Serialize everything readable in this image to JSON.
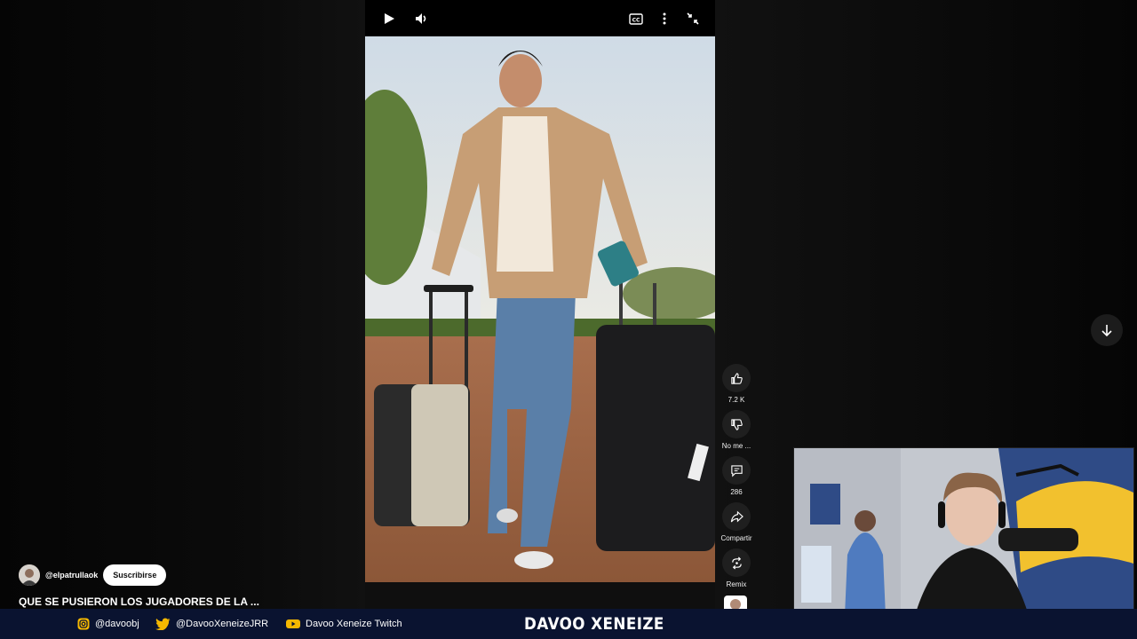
{
  "short": {
    "channel": "@elpatrullaok",
    "subscribe_label": "Suscribirse",
    "title": "QUE SE PUSIERON LOS JUGADORES DE LA ..."
  },
  "actions": {
    "like_count": "7.2 K",
    "dislike_label": "No me ...",
    "comments_count": "286",
    "share_label": "Compartir",
    "remix_label": "Remix"
  },
  "banner": {
    "instagram": "@davoobj",
    "twitter": "@DavooXeneizeJRR",
    "twitch": "Davoo Xeneize Twitch",
    "brand": "DAVOO XENEIZE"
  },
  "icons": {
    "play": "play-icon",
    "volume": "volume-icon",
    "captions": "captions-icon",
    "more": "more-vert-icon",
    "exit_fullscreen": "exit-fullscreen-icon",
    "scroll_down": "arrow-down-icon"
  },
  "colors": {
    "background": "#0f0f0f",
    "banner": "#0a1330",
    "subscribe_bg": "#ffffff",
    "action_bg": "#1f1f1f"
  }
}
